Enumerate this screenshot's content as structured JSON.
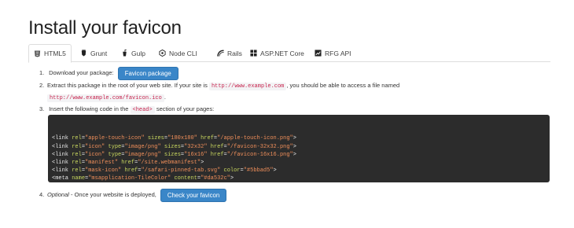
{
  "page": {
    "title": "Install your favicon"
  },
  "tabs": [
    {
      "label": "HTML5",
      "icon": "html5-icon",
      "active": true
    },
    {
      "label": "Grunt",
      "icon": "grunt-icon",
      "active": false
    },
    {
      "label": "Gulp",
      "icon": "gulp-icon",
      "active": false
    },
    {
      "label": "Node CLI",
      "icon": "node-cli-icon",
      "active": false
    },
    {
      "label": "Rails",
      "icon": "rails-icon",
      "active": false
    },
    {
      "label": "ASP.NET Core",
      "icon": "aspnet-core-icon",
      "active": false
    },
    {
      "label": "RFG API",
      "icon": "rfg-api-icon",
      "active": false
    }
  ],
  "steps": {
    "s1": {
      "num": "1.",
      "text": "Download your package:",
      "button": "Favicon package"
    },
    "s2": {
      "num": "2.",
      "text_a": "Extract this package in the root of your web site. If your site is",
      "code_a": "http://www.example.com",
      "text_b": ", you should be able to access a file named",
      "code_b": "http://www.example.com/favicon.ico",
      "text_c": "."
    },
    "s3": {
      "num": "3.",
      "text_a": "Insert the following code in the",
      "code": "<head>",
      "text_b": "section of your pages:"
    },
    "s4": {
      "num": "4.",
      "optional": "Optional",
      "text": " - Once your website is deployed,",
      "button": "Check your favicon"
    }
  },
  "code_lines": [
    [
      {
        "t": "tg",
        "v": "<link "
      },
      {
        "t": "at",
        "v": "rel"
      },
      {
        "t": "eq",
        "v": "="
      },
      {
        "t": "vl",
        "v": "\"apple-touch-icon\""
      },
      {
        "t": "tg",
        "v": " "
      },
      {
        "t": "at",
        "v": "sizes"
      },
      {
        "t": "eq",
        "v": "="
      },
      {
        "t": "vl",
        "v": "\"180x180\""
      },
      {
        "t": "tg",
        "v": " "
      },
      {
        "t": "at",
        "v": "href"
      },
      {
        "t": "eq",
        "v": "="
      },
      {
        "t": "vl",
        "v": "\"/apple-touch-icon.png\""
      },
      {
        "t": "tg",
        "v": ">"
      }
    ],
    [
      {
        "t": "tg",
        "v": "<link "
      },
      {
        "t": "at",
        "v": "rel"
      },
      {
        "t": "eq",
        "v": "="
      },
      {
        "t": "vl",
        "v": "\"icon\""
      },
      {
        "t": "tg",
        "v": " "
      },
      {
        "t": "at",
        "v": "type"
      },
      {
        "t": "eq",
        "v": "="
      },
      {
        "t": "vl",
        "v": "\"image/png\""
      },
      {
        "t": "tg",
        "v": " "
      },
      {
        "t": "at",
        "v": "sizes"
      },
      {
        "t": "eq",
        "v": "="
      },
      {
        "t": "vl",
        "v": "\"32x32\""
      },
      {
        "t": "tg",
        "v": " "
      },
      {
        "t": "at",
        "v": "href"
      },
      {
        "t": "eq",
        "v": "="
      },
      {
        "t": "vl",
        "v": "\"/favicon-32x32.png\""
      },
      {
        "t": "tg",
        "v": ">"
      }
    ],
    [
      {
        "t": "tg",
        "v": "<link "
      },
      {
        "t": "at",
        "v": "rel"
      },
      {
        "t": "eq",
        "v": "="
      },
      {
        "t": "vl",
        "v": "\"icon\""
      },
      {
        "t": "tg",
        "v": " "
      },
      {
        "t": "at",
        "v": "type"
      },
      {
        "t": "eq",
        "v": "="
      },
      {
        "t": "vl",
        "v": "\"image/png\""
      },
      {
        "t": "tg",
        "v": " "
      },
      {
        "t": "at",
        "v": "sizes"
      },
      {
        "t": "eq",
        "v": "="
      },
      {
        "t": "vl",
        "v": "\"16x16\""
      },
      {
        "t": "tg",
        "v": " "
      },
      {
        "t": "at",
        "v": "href"
      },
      {
        "t": "eq",
        "v": "="
      },
      {
        "t": "vl",
        "v": "\"/favicon-16x16.png\""
      },
      {
        "t": "tg",
        "v": ">"
      }
    ],
    [
      {
        "t": "tg",
        "v": "<link "
      },
      {
        "t": "at",
        "v": "rel"
      },
      {
        "t": "eq",
        "v": "="
      },
      {
        "t": "vl",
        "v": "\"manifest\""
      },
      {
        "t": "tg",
        "v": " "
      },
      {
        "t": "at",
        "v": "href"
      },
      {
        "t": "eq",
        "v": "="
      },
      {
        "t": "vl",
        "v": "\"/site.webmanifest\""
      },
      {
        "t": "tg",
        "v": ">"
      }
    ],
    [
      {
        "t": "tg",
        "v": "<link "
      },
      {
        "t": "at",
        "v": "rel"
      },
      {
        "t": "eq",
        "v": "="
      },
      {
        "t": "vl",
        "v": "\"mask-icon\""
      },
      {
        "t": "tg",
        "v": " "
      },
      {
        "t": "at",
        "v": "href"
      },
      {
        "t": "eq",
        "v": "="
      },
      {
        "t": "vl",
        "v": "\"/safari-pinned-tab.svg\""
      },
      {
        "t": "tg",
        "v": " "
      },
      {
        "t": "at",
        "v": "color"
      },
      {
        "t": "eq",
        "v": "="
      },
      {
        "t": "vl",
        "v": "\"#5bbad5\""
      },
      {
        "t": "tg",
        "v": ">"
      }
    ],
    [
      {
        "t": "tg",
        "v": "<meta "
      },
      {
        "t": "at",
        "v": "name"
      },
      {
        "t": "eq",
        "v": "="
      },
      {
        "t": "vl",
        "v": "\"msapplication-TileColor\""
      },
      {
        "t": "tg",
        "v": " "
      },
      {
        "t": "at",
        "v": "content"
      },
      {
        "t": "eq",
        "v": "="
      },
      {
        "t": "vl",
        "v": "\"#da532c\""
      },
      {
        "t": "tg",
        "v": ">"
      }
    ],
    [
      {
        "t": "tg",
        "v": "<meta "
      },
      {
        "t": "at",
        "v": "name"
      },
      {
        "t": "eq",
        "v": "="
      },
      {
        "t": "vl",
        "v": "\"theme-color\""
      },
      {
        "t": "tg",
        "v": " "
      },
      {
        "t": "at",
        "v": "content"
      },
      {
        "t": "eq",
        "v": "="
      },
      {
        "t": "vl",
        "v": "\"#ffffff\""
      },
      {
        "t": "tg",
        "v": ">"
      }
    ]
  ],
  "colors": {
    "button": "#3a86c8",
    "code_background": "#2c2c2c",
    "inline_code": "#c7254e",
    "syntax_attribute": "#c9d75f",
    "syntax_value": "#f08f5a"
  }
}
